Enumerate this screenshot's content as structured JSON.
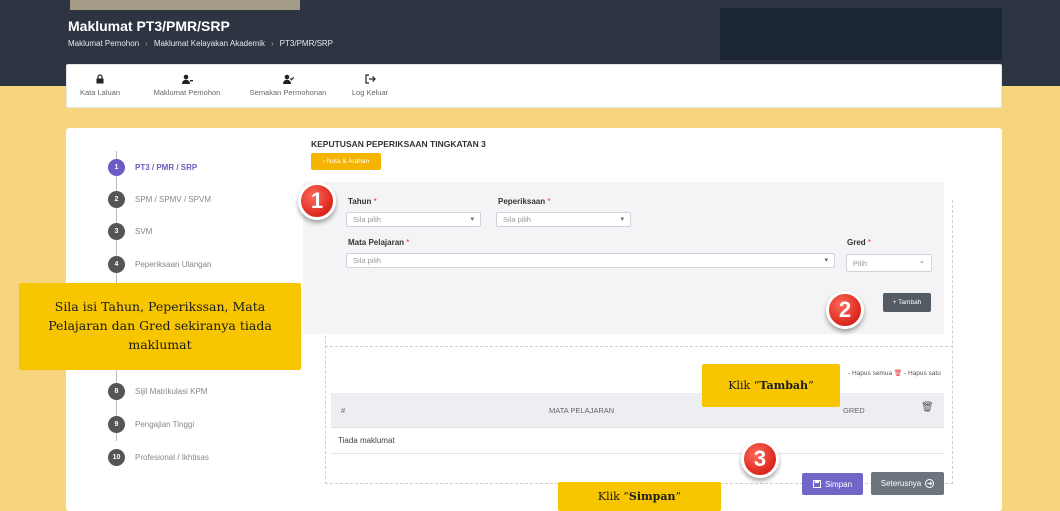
{
  "header": {
    "title": "Maklumat PT3/PMR/SRP",
    "breadcrumb": [
      "Maklumat Pemohon",
      "Maklumat Kelayakan Akademik",
      "PT3/PMR/SRP"
    ],
    "separator": "›"
  },
  "nav": {
    "items": [
      {
        "label": "Kata Laluan",
        "icon": "lock-icon"
      },
      {
        "label": "Maklumat Pemohon",
        "icon": "user-icon"
      },
      {
        "label": "Semakan Permohonan",
        "icon": "user-check-icon"
      },
      {
        "label": "Log Keluar",
        "icon": "logout-icon"
      }
    ]
  },
  "steps": [
    {
      "num": "1",
      "label": "PT3 / PMR / SRP",
      "active": true
    },
    {
      "num": "2",
      "label": "SPM / SPMV / SPVM"
    },
    {
      "num": "3",
      "label": "SVM"
    },
    {
      "num": "4",
      "label": "Peperiksaan Ulangan"
    },
    {
      "num": "8",
      "label": "Sijil Matrikulasi KPM"
    },
    {
      "num": "9",
      "label": "Pengajian Tinggi"
    },
    {
      "num": "10",
      "label": "Profesional / Ikhtisas"
    }
  ],
  "section": {
    "title": "KEPUTUSAN PEPERIKSAAN TINGKATAN 3",
    "nota_button": "› Nota & Arahan"
  },
  "form": {
    "tahun": {
      "label": "Tahun",
      "placeholder": "Sila pilih"
    },
    "peperiksaan": {
      "label": "Peperiksaan",
      "placeholder": "Sila pilih"
    },
    "mata_pelajaran": {
      "label": "Mata Pelajaran",
      "placeholder": "Sila pilih"
    },
    "gred": {
      "label": "Gred",
      "placeholder": "Pilih"
    },
    "required_mark": "*",
    "tambah_button": "+ Tambah"
  },
  "legend": {
    "hapus_semua": "- Hapus semua",
    "hapus_satu": "- Hapus satu"
  },
  "table": {
    "columns": [
      "#",
      "MATA PELAJARAN",
      "GRED"
    ],
    "empty_text": "Tiada maklumat"
  },
  "buttons": {
    "simpan": "Simpan",
    "seterusnya": "Seterusnya"
  },
  "annotations": {
    "callout_main": "Sila isi Tahun, Peperikssan, Mata Pelajaran dan Gred sekiranya tiada maklumat",
    "callout_tambah_prefix": "Klik “",
    "callout_tambah_bold": "Tambah",
    "callout_tambah_suffix": "”",
    "callout_simpan_prefix": "Klik “",
    "callout_simpan_bold": "Simpan",
    "callout_simpan_suffix": "”",
    "badge_1": "1",
    "badge_2": "2",
    "badge_3": "3"
  },
  "colors": {
    "accent": "#6c5cc4",
    "nota": "#f4b400",
    "callout": "#f7c600",
    "badge": "#e02a1f"
  }
}
